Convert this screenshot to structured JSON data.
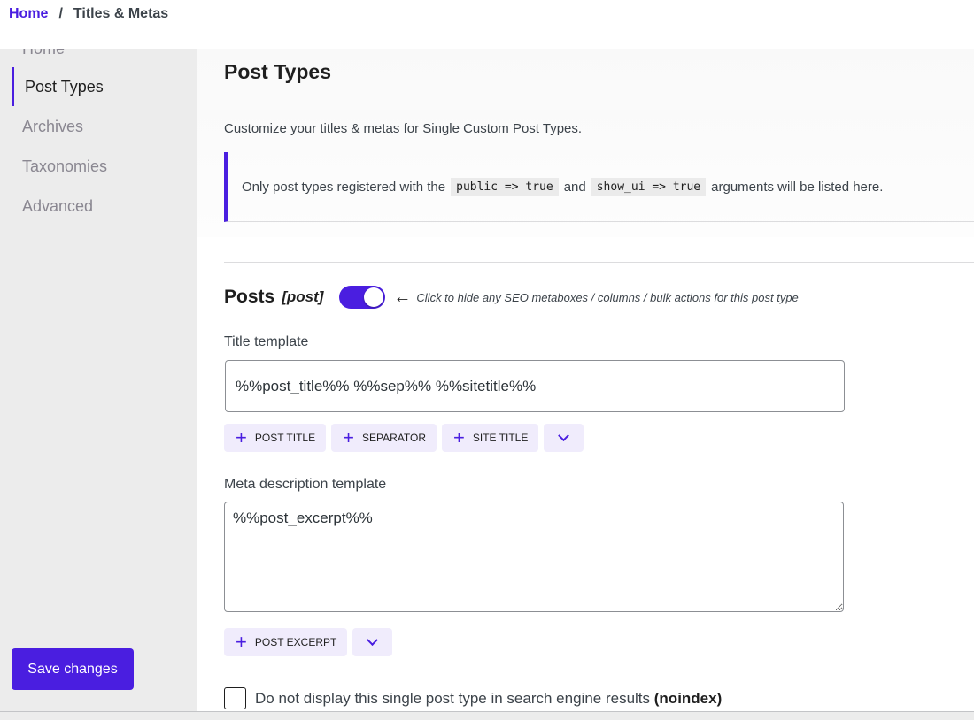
{
  "breadcrumb": {
    "home": "Home",
    "separator": "/",
    "current": "Titles & Metas"
  },
  "sidebar": {
    "items": [
      {
        "label": "Home",
        "active": false
      },
      {
        "label": "Post Types",
        "active": true
      },
      {
        "label": "Archives",
        "active": false
      },
      {
        "label": "Taxonomies",
        "active": false
      },
      {
        "label": "Advanced",
        "active": false
      }
    ],
    "save_label": "Save changes"
  },
  "main": {
    "title": "Post Types",
    "description": "Customize your titles & metas for Single Custom Post Types.",
    "notice": {
      "prefix": "Only post types registered with the",
      "code1": "public => true",
      "middle": "and",
      "code2": "show_ui => true",
      "suffix": "arguments will be listed here."
    },
    "post_type": {
      "name": "Posts",
      "slug": "[post]",
      "toggle_on": true,
      "toggle_hint": "Click to hide any SEO metaboxes / columns / bulk actions for this post type",
      "title_label": "Title template",
      "title_value": "%%post_title%% %%sep%% %%sitetitle%%",
      "title_tags": [
        "POST TITLE",
        "SEPARATOR",
        "SITE TITLE"
      ],
      "desc_label": "Meta description template",
      "desc_value": "%%post_excerpt%%",
      "desc_tags": [
        "POST EXCERPT"
      ],
      "noindex_label": "Do not display this single post type in search engine results",
      "noindex_bold": "(noindex)",
      "noindex_checked": false
    }
  },
  "colors": {
    "accent": "#4a1ee0",
    "tag_bg": "#f0ecfc",
    "sidebar_bg": "#ececec"
  }
}
